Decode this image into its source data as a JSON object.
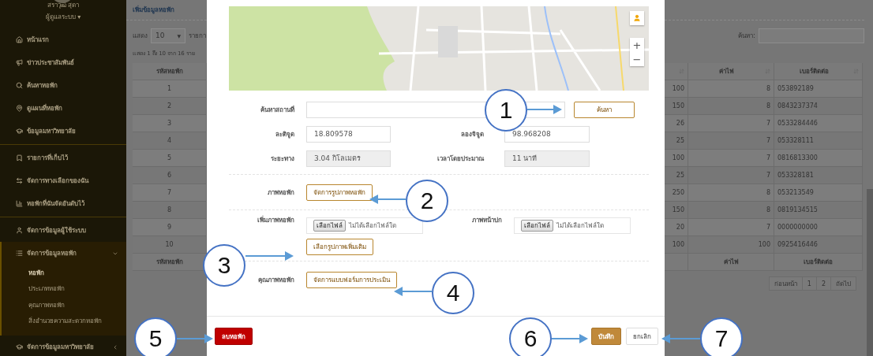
{
  "sidebar": {
    "user_name": "สราวุฒิ สุดา",
    "role": "ผู้ดูแลระบบ",
    "role_caret": "▾",
    "groups": [
      [
        {
          "label": "หน้าแรก"
        },
        {
          "label": "ข่าวประชาสัมพันธ์"
        },
        {
          "label": "ค้นหาหอพัก"
        },
        {
          "label": "ดูแผนที่หอพัก"
        },
        {
          "label": "ข้อมูลมหาวิทยาลัย"
        }
      ],
      [
        {
          "label": "รายการที่เก็บไว้"
        },
        {
          "label": "จัดการทางเลือกของฉัน"
        },
        {
          "label": "หอพักที่ฉันจัดอันดับไว้"
        }
      ],
      [
        {
          "label": "จัดการข้อมูลผู้ใช้ระบบ"
        },
        {
          "label": "จัดการข้อมูลหอพัก",
          "expanded": true,
          "children": [
            {
              "label": "หอพัก",
              "selected": true
            },
            {
              "label": "ประเภทหอพัก",
              "selected": false
            },
            {
              "label": "คุณภาพหอพัก",
              "selected": false
            },
            {
              "label": "สิ่งอำนวยความสะดวกหอพัก",
              "selected": false
            }
          ]
        },
        {
          "label": "จัดการข้อมูลมหาวิทยาลัย",
          "expanded": false
        }
      ]
    ]
  },
  "page": {
    "title": "เพิ่มข้อมูลหอพัก",
    "length_label": "แสดง",
    "length_value": "10",
    "length_caret": "▼",
    "length_suffix": "รายกา",
    "info": "แสดง 1 ถึง 10 จาก 16 ราย",
    "search_label": "ค้นหา:"
  },
  "table": {
    "left_header": "รหัสหอพัก",
    "right_headers": [
      "ค่าไฟ",
      "เบอร์ติดต่อ"
    ],
    "rows": [
      {
        "id": "1",
        "column_3": "100",
        "electricity": "8",
        "phone": "053892189"
      },
      {
        "id": "2",
        "column_3": "150",
        "electricity": "8",
        "phone": "0843237374"
      },
      {
        "id": "3",
        "column_3": "26",
        "electricity": "7",
        "phone": "0533284446"
      },
      {
        "id": "4",
        "column_3": "25",
        "electricity": "7",
        "phone": "053328111"
      },
      {
        "id": "5",
        "column_3": "100",
        "electricity": "7",
        "phone": "0816813300"
      },
      {
        "id": "6",
        "column_3": "25",
        "electricity": "7",
        "phone": "053328181"
      },
      {
        "id": "7",
        "column_3": "250",
        "electricity": "8",
        "phone": "053213549"
      },
      {
        "id": "8",
        "column_3": "150",
        "electricity": "8",
        "phone": "0819134515"
      },
      {
        "id": "9",
        "column_3": "20",
        "electricity": "7",
        "phone": "0000000000"
      },
      {
        "id": "10",
        "column_3": "100",
        "electricity": "100",
        "phone": "0925416446"
      }
    ],
    "footer_left": "รหัสหอพัก",
    "footer_right": [
      "ค่าไฟ",
      "เบอร์ติดต่อ"
    ]
  },
  "pagination": [
    "ก่อนหน้า",
    "1",
    "2",
    "ถัดไป"
  ],
  "modal": {
    "map": {
      "zoom_in": "+",
      "zoom_out": "−"
    },
    "search": {
      "label": "ค้นหาสถานที่",
      "button": "ค้นหา"
    },
    "latitude": {
      "label": "ละติจูด",
      "value": "18.809578"
    },
    "longitude": {
      "label": "ลองจิจูด",
      "value": "98.968208"
    },
    "distance": {
      "label": "ระยะทาง",
      "value": "3.04 กิโลเมตร"
    },
    "duration": {
      "label": "เวลาโดยประมาณ",
      "value": "11 นาที"
    },
    "photos": {
      "label": "ภาพหอพัก",
      "button": "จัดการรูปภาพหอพัก"
    },
    "add_photo": {
      "label": "เพิ่มภาพหอพัก",
      "file_button": "เลือกไฟล์",
      "file_status": "ไม่ได้เลือกไฟล์ใด"
    },
    "cover_photo": {
      "label": "ภาพหน้าปก",
      "file_button": "เลือกไฟล์",
      "file_status": "ไม่ได้เลือกไฟล์ใด"
    },
    "more_photos_button": "เลือกรูปภาพเพิ่มเติม",
    "quality": {
      "label": "คุณภาพหอพัก",
      "button": "จัดการแบบฟอร์มการประเมิน"
    },
    "delete_button": "ลบหอพัก",
    "save_button": "บันทึก",
    "cancel_button": "ยกเลิก"
  },
  "callouts": [
    {
      "number": "1"
    },
    {
      "number": "2"
    },
    {
      "number": "3"
    },
    {
      "number": "4"
    },
    {
      "number": "5"
    },
    {
      "number": "6"
    },
    {
      "number": "7"
    }
  ]
}
